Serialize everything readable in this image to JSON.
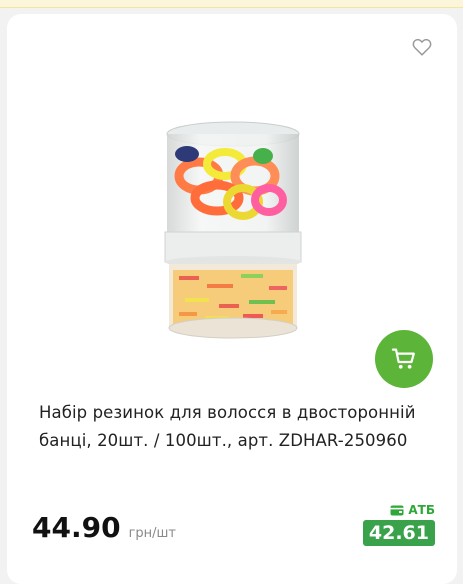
{
  "product": {
    "title": "Набір резинок для волосся в двосторонній банці, 20шт. / 100шт., арт. ZDHAR-250960",
    "price": "44.90",
    "unit": "грн/шт",
    "promo_label": "АТБ",
    "promo_price": "42.61"
  },
  "icons": {
    "favorite": "heart-outline-icon",
    "cart": "shopping-cart-icon",
    "promo": "wallet-icon"
  },
  "colors": {
    "accent_green": "#5cb538",
    "promo_green": "#3aa24a",
    "price_text": "#111111"
  }
}
